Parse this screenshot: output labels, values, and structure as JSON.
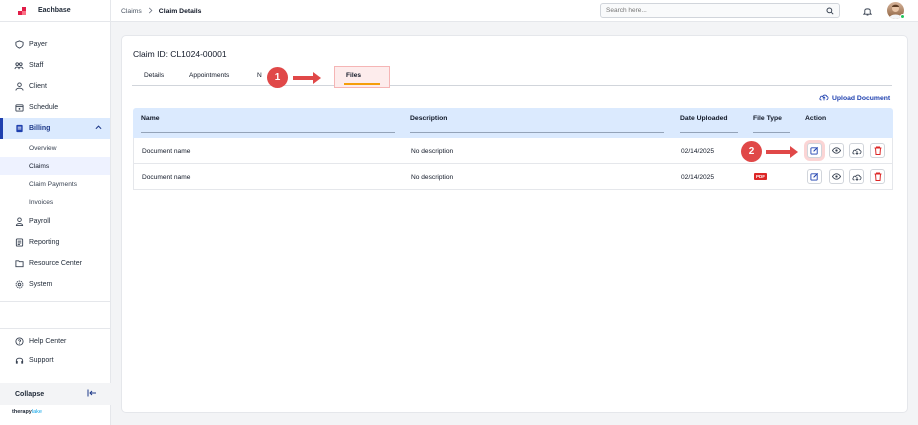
{
  "app": {
    "brand": "Eachbase",
    "footer_logo_a": "therapy",
    "footer_logo_b": "lake"
  },
  "sidebar": {
    "items": [
      {
        "label": "Payer",
        "icon": "shield-icon"
      },
      {
        "label": "Staff",
        "icon": "staff-icon"
      },
      {
        "label": "Client",
        "icon": "client-icon"
      },
      {
        "label": "Schedule",
        "icon": "calendar-icon"
      },
      {
        "label": "Billing",
        "icon": "billing-icon"
      },
      {
        "label": "Payroll",
        "icon": "payroll-icon"
      },
      {
        "label": "Reporting",
        "icon": "report-icon"
      },
      {
        "label": "Resource Center",
        "icon": "folder-icon"
      },
      {
        "label": "System",
        "icon": "gear-icon"
      }
    ],
    "billing_sub": [
      "Overview",
      "Claims",
      "Claim Payments",
      "Invoices"
    ],
    "bottom": [
      {
        "label": "Help Center",
        "icon": "help-icon"
      },
      {
        "label": "Support",
        "icon": "headset-icon"
      }
    ],
    "collapse_label": "Collapse"
  },
  "topbar": {
    "breadcrumb_parent": "Claims",
    "breadcrumb_current": "Claim Details",
    "search_placeholder": "Search here..."
  },
  "page": {
    "claim_title": "Claim ID: CL1024-00001",
    "tabs": [
      "Details",
      "Appointments",
      "N",
      "Files"
    ],
    "upload_label": "Upload Document",
    "columns": [
      "Name",
      "Description",
      "Date Uploaded",
      "File Type",
      "Action"
    ],
    "rows": [
      {
        "name": "Document name",
        "description": "No description",
        "date": "02/14/2025"
      },
      {
        "name": "Document name",
        "description": "No description",
        "date": "02/14/2025",
        "type": "PDF"
      }
    ],
    "markers": [
      "1",
      "2"
    ]
  },
  "colors": {
    "accent": "#1e40af",
    "marker": "#e04848",
    "tab_underline": "#f59e0b"
  }
}
